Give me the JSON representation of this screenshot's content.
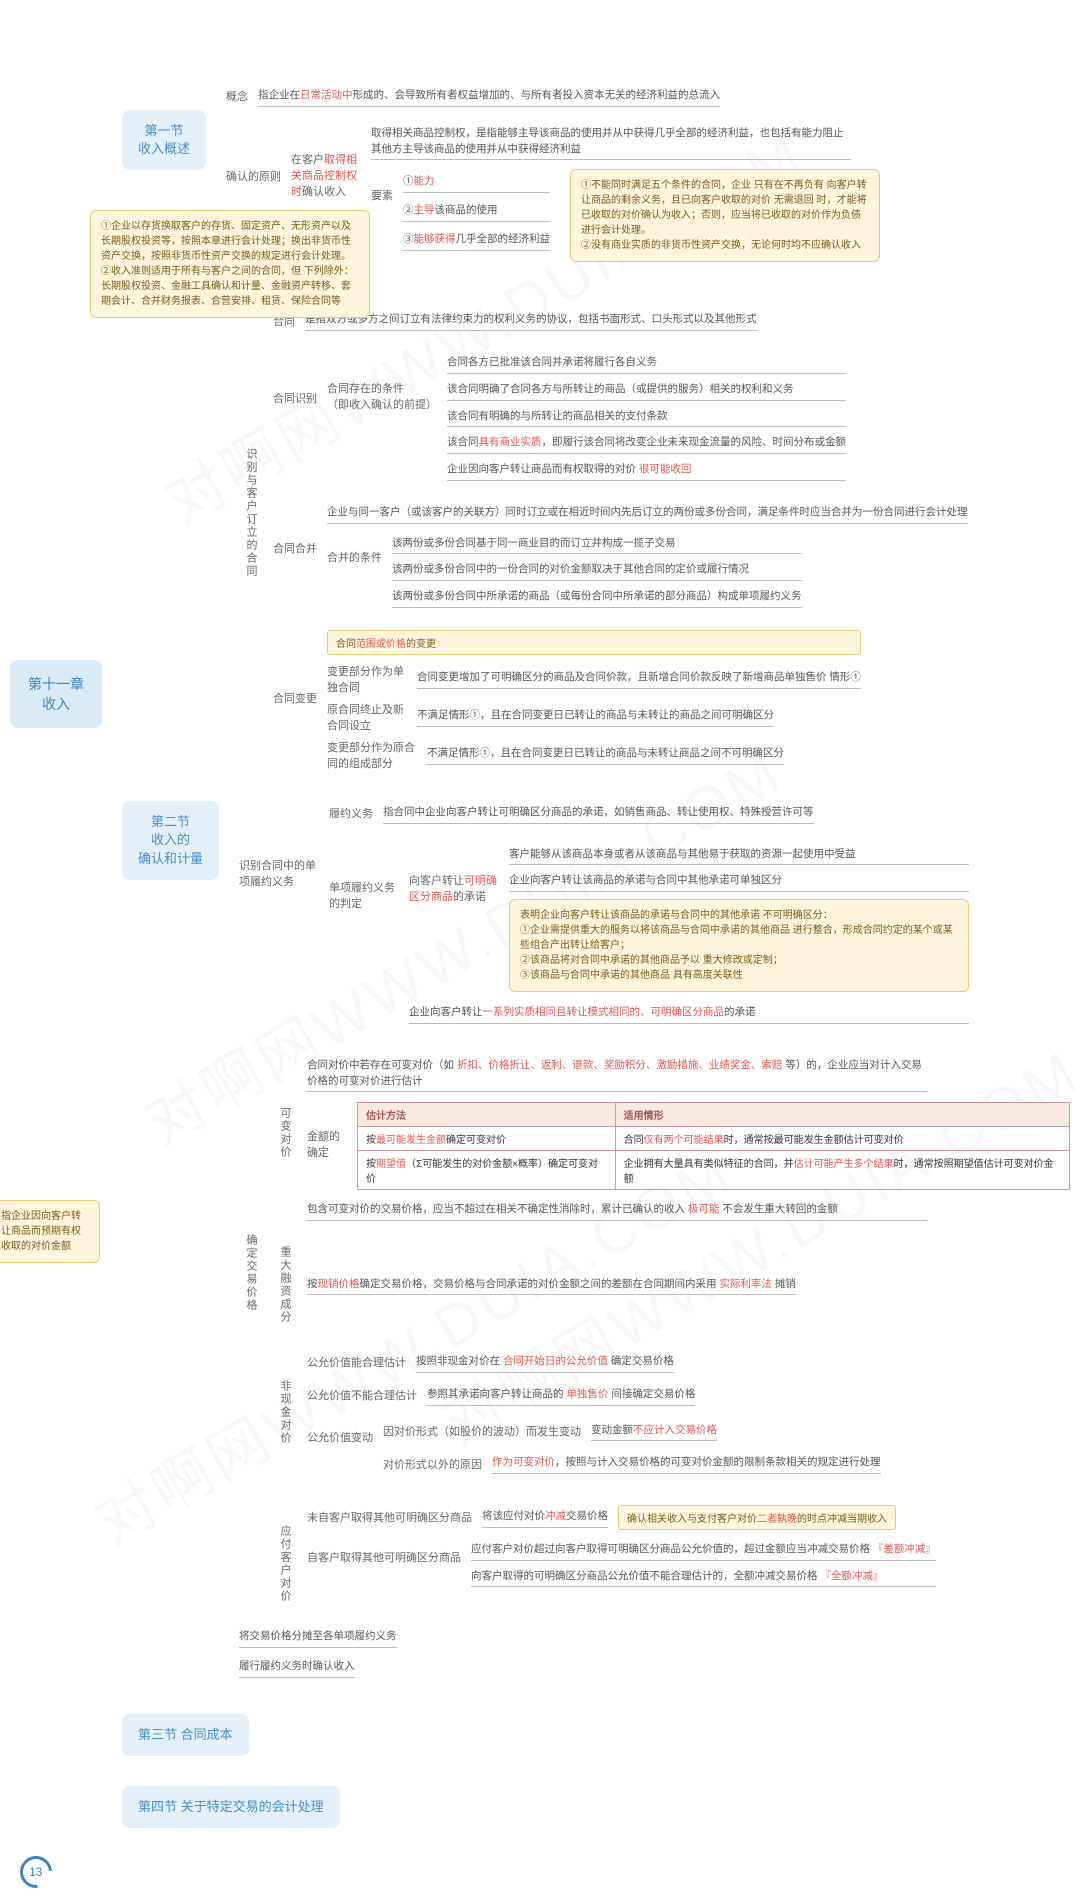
{
  "page_num": "13",
  "watermark": "对啊网WWW.DUIA.COM",
  "root": "第十一章\n收入",
  "s1": {
    "title": "第一节\n收入概述",
    "concept_label": "概念",
    "concept_text": "指企业在日常活动中形成的、会导致所有者权益增加的、与所有者投入资本无关的经济利益的总流入",
    "concept_red": "日常活动中",
    "principle_label": "确认的原则",
    "p_when": "在客户取得相关商品控制权时确认收入",
    "p_when_red": "取得相关商品控制权时",
    "p_ctrl": "取得相关商品控制权，是指能够主导该商品的使用并从中获得几乎全部的经济利益，也包括有能力阻止其他方主导该商品的使用并从中获得经济利益",
    "p_ele_label": "要素",
    "p_e1": "①能力",
    "p_e2": "②主导该商品的使用",
    "p_e3": "③能够获得几乎全部的经济利益",
    "p_e1_red": "能力",
    "p_e2_red": "主导",
    "p_e3_red": "能够获得",
    "callout_right": "①不能同时满足五个条件的合同，企业 只有在不再负有 向客户转让商品的剩余义务，且已向客户收取的对价 无需退回 时，才能将已收取的对价确认为收入；否则，应当将已收取的对价作为负债进行会计处理。\n②没有商业实质的非货币性资产交换，无论何时均不应确认收入",
    "callout_left": "①企业以存货换取客户的存货、固定资产、无形资产以及长期股权投资等，按照本章进行会计处理；换出非货币性资产交换，按照非货币性资产交换的规定进行会计处理。\n②收入准则适用于所有与客户之间的合同，但 下列除外：长期股权投资、金融工具确认和计量、金融资产转移、套期会计、合并财务报表、合营安排、租赁、保险合同等"
  },
  "s2": {
    "title": "第二节\n收入的\n确认和计量",
    "b1_label": "识别与客户订立的合同",
    "contract_def": "是指双方或多方之间订立有法律约束力的权利义务的协议，包括书面形式、口头形式以及其他形式",
    "contract_label": "合同",
    "rec_label": "合同识别",
    "rec_cond_label": "合同存在的条件\n（即收入确认的前提）",
    "rc1": "合同各方已批准该合同并承诺将履行各自义务",
    "rc2": "该合同明确了合同各方与所转让的商品（或提供的服务）相关的权利和义务",
    "rc3": "该合同有明确的与所转让的商品相关的支付条款",
    "rc4": "该合同具有商业实质，即履行该合同将改变企业未来现金流量的风险、时间分布或金额",
    "rc4_red": "具有商业实质",
    "rc5": "企业因向客户转让商品而有权取得的对价 很可能收回",
    "rc5_red": "很可能收回",
    "merge_label": "合同合并",
    "merge_intro": "企业与同一客户（或该客户的关联方）同时订立或在相近时间内先后订立的两份或多份合同，满足条件时应当合并为一份合同进行会计处理",
    "merge_cond_label": "合并的条件",
    "mc1": "该两份或多份合同基于同一商业目的而订立并构成一揽子交易",
    "mc2": "该两份或多份合同中的一份合同的对价金额取决于其他合同的定价或履行情况",
    "mc3": "该两份或多份合同中所承诺的商品（或每份合同中所承诺的部分商品）构成单项履约义务",
    "change_label": "合同变更",
    "change_hl": "合同范围或价格的变更",
    "ch1_label": "变更部分作为单独合同",
    "ch1": "合同变更增加了可明确区分的商品及合同价款，且新增合同价款反映了新增商品单独售价  情形①",
    "ch2_label": "原合同终止及新合同设立",
    "ch2": "不满足情形①，且在合同变更日已转让的商品与未转让的商品之间可明确区分",
    "ch3_label": "变更部分作为原合同的组成部分",
    "ch3": "不满足情形①，且在合同变更日已转让的商品与未转让商品之间不可明确区分",
    "b2_label": "识别合同中的单项履约义务",
    "perf_label": "履约义务",
    "perf_def": "指合同中企业向客户转让可明确区分商品的承诺，如销售商品、转让使用权、特殊授营许可等",
    "single_label": "单项履约义务的判定",
    "single_to": "向客户转让可明确区分商品的承诺",
    "single_to_red": "可明确区分商品",
    "sg1": "客户能够从该商品本身或者从该商品与其他易于获取的资源一起使用中受益",
    "sg2": "企业向客户转让该商品的承诺与合同中其他承诺可单独区分",
    "sg_callout": "表明企业向客户转让该商品的承诺与合同中的其他承诺 不可明确区分：\n①企业需提供重大的服务以将该商品与合同中承诺的其他商品 进行整合，形成合同约定的某个或某些组合产出转让给客户；\n②该商品将对合同中承诺的其他商品予以 重大修改或定制；\n③该商品与合同中承诺的其他商品 具有高度关联性",
    "series": "企业向客户转让一系列实质相同且转让模式相同的、可明确区分商品的承诺",
    "series_red": "一系列实质相同且转让模式相同的、可明确区分商品",
    "b3_label": "确定交易价格",
    "b3_side": "指企业因向客户转让商品而预期有权收取的对价金额",
    "var_label": "可变对价",
    "var_intro": "合同对价中若存在可变对价（如 折扣、价格折让、返利、退款、奖励积分、激励措施、业绩奖金、索赔 等）的，企业应当对计入交易价格的可变对价进行估计",
    "var_intro_red": "折扣、价格折让、返利、退款、奖励积分、激励措施、业绩奖金、索赔",
    "var_amt_label": "金额的确定",
    "tbl_h1": "估计方法",
    "tbl_h2": "适用情形",
    "tbl_r1c1": "按最可能发生金额确定可变对价",
    "tbl_r1c2": "合同仅有两个可能结果时，通常按最可能发生金额估计可变对价",
    "tbl_r2c1": "按期望值（Σ可能发生的对价金额×概率）确定可变对价",
    "tbl_r2c2": "企业拥有大量具有类似特征的合同，并估计可能产生多个结果时，通常按照期望值估计可变对价金额",
    "var_limit": "包含可变对价的交易价格，应当不超过在相关不确定性消除时，累计已确认的收入 极可能 不会发生重大转回的金额",
    "var_limit_red": "极可能",
    "fin_label": "重大融资成分",
    "fin_text": "按现销价格确定交易价格，交易价格与合同承诺的对价金额之间的差额在合同期间内采用 实际利率法 摊销",
    "fin_red1": "现销价格",
    "fin_red2": "实际利率法",
    "noncash_label": "非现金对价",
    "nc1_label": "公允价值能合理估计",
    "nc1": "按照非现金对价在 合同开始日的公允价值 确定交易价格",
    "nc2_label": "公允价值不能合理估计",
    "nc2": "参照其承诺向客户转让商品的 单独售价 间接确定交易价格",
    "nc3_label": "公允价值变动",
    "nc3a_label": "因对价形式（如股价的波动）而发生变动",
    "nc3a": "变动金额不应计入交易价格",
    "nc3b_label": "对价形式以外的原因",
    "nc3b": "作为可变对价，按照与计入交易价格的可变对价金额的限制条款相关的规定进行处理",
    "pay_label": "应付客户对价",
    "pay1_label": "未自客户取得其他可明确区分商品",
    "pay1": "将该应付对价冲减交易价格",
    "pay1_red": "冲减",
    "pay1_hl": "确认相关收入与支付客户对价二者孰晚的时点冲减当期收入",
    "pay2_label": "自客户取得其他可明确区分商品",
    "pay2a": "应付客户对价超过向客户取得可明确区分商品公允价值的，超过金额应当冲减交易价格 『差额冲减』",
    "pay2b": "向客户取得的可明确区分商品公允价值不能合理估计的，全额冲减交易价格 『全额冲减』",
    "b4": "将交易价格分摊至各单项履约义务",
    "b5": "履行履约义务时确认收入"
  },
  "s3": "第三节  合同成本",
  "s4": "第四节  关于特定交易的会计处理"
}
